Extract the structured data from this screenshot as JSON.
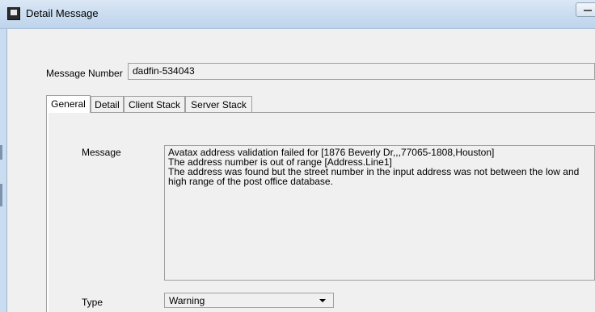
{
  "window": {
    "title": "Detail Message",
    "icon": "app-icon"
  },
  "form": {
    "message_number_label": "Message Number",
    "message_number_value": "ɗadfin-534043"
  },
  "tabs": [
    {
      "label": "General",
      "active": true
    },
    {
      "label": "Detail",
      "active": false
    },
    {
      "label": "Client Stack",
      "active": false
    },
    {
      "label": "Server Stack",
      "active": false
    }
  ],
  "general": {
    "message_label": "Message",
    "message_lines": [
      "Avatax address validation failed for [1876 Beverly Dr,,,77065-1808,Houston]",
      "The address number is out of range [Address.Line1]",
      "The address was found but the street number in the input address was not between the low and high range of the post office database."
    ],
    "type_label": "Type",
    "type_value": "Warning"
  },
  "colors": {
    "titlebar": "#c9dcf0",
    "client_bg": "#f0f0f0",
    "border": "#a0a0a0"
  }
}
